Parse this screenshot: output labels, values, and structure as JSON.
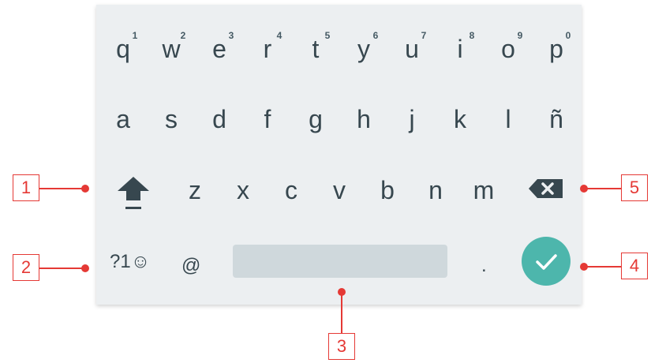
{
  "keyboard": {
    "row1": [
      {
        "letter": "q",
        "hint": "1"
      },
      {
        "letter": "w",
        "hint": "2"
      },
      {
        "letter": "e",
        "hint": "3"
      },
      {
        "letter": "r",
        "hint": "4"
      },
      {
        "letter": "t",
        "hint": "5"
      },
      {
        "letter": "y",
        "hint": "6"
      },
      {
        "letter": "u",
        "hint": "7"
      },
      {
        "letter": "i",
        "hint": "8"
      },
      {
        "letter": "o",
        "hint": "9"
      },
      {
        "letter": "p",
        "hint": "0"
      }
    ],
    "row2": [
      "a",
      "s",
      "d",
      "f",
      "g",
      "h",
      "j",
      "k",
      "l",
      "ñ"
    ],
    "row3": [
      "z",
      "x",
      "c",
      "v",
      "b",
      "n",
      "m"
    ],
    "symbols_label": "?1☺",
    "at_label": "@",
    "period_label": ".",
    "icons": {
      "shift": "shift-arrow-icon",
      "backspace": "backspace-icon",
      "enter": "checkmark-icon"
    },
    "colors": {
      "background": "#eceff1",
      "key_text": "#37474f",
      "spacebar": "#cfd8dc",
      "enter": "#4db6ac"
    }
  },
  "callouts": {
    "shift": "1",
    "symbols": "2",
    "space": "3",
    "enter": "4",
    "backspace": "5",
    "color": "#e53935"
  }
}
